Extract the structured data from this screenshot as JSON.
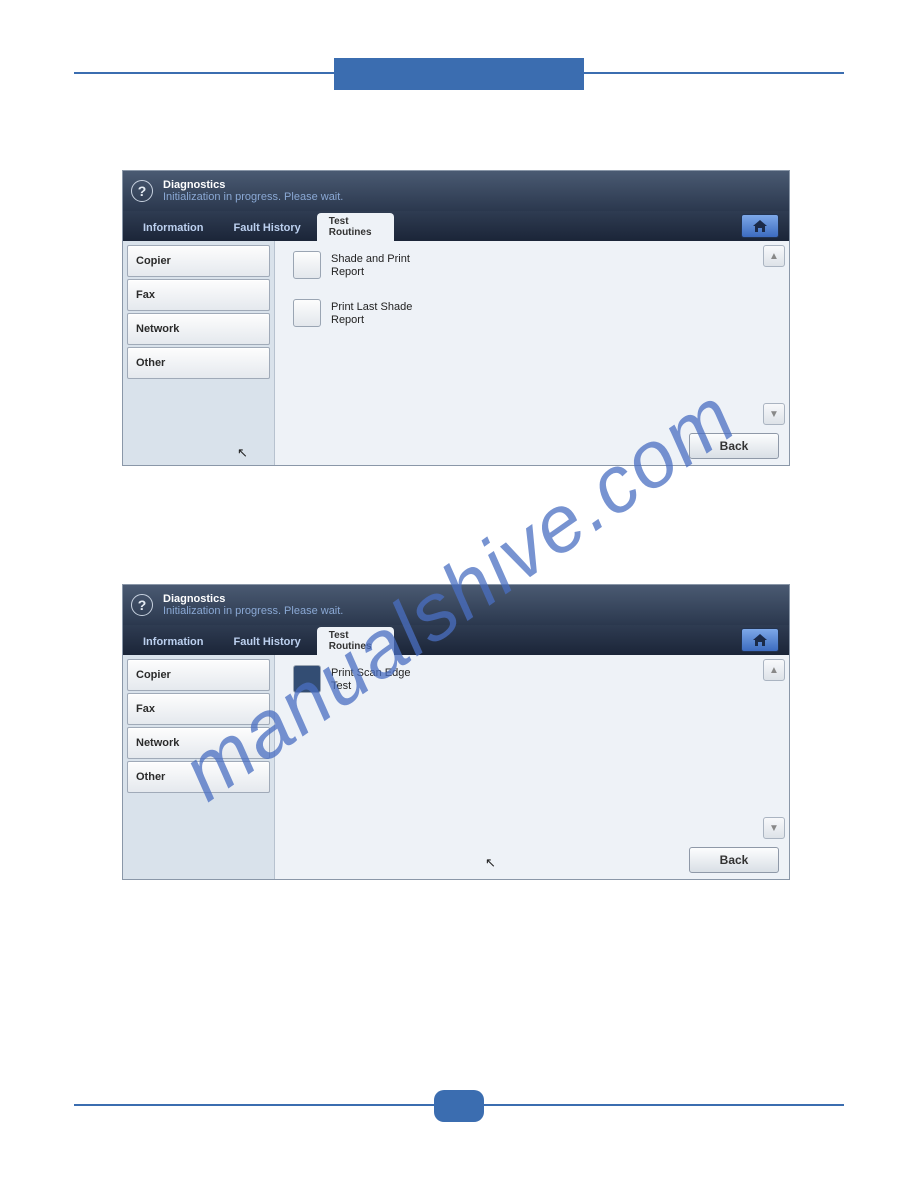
{
  "watermark": "manualshive.com",
  "panels": [
    {
      "title": "Diagnostics",
      "subtitle": "Initialization in progress. Please wait.",
      "tabs": {
        "info": "Information",
        "fault": "Fault History",
        "test_l1": "Test",
        "test_l2": "Routines"
      },
      "sidebar": {
        "copier": "Copier",
        "fax": "Fax",
        "network": "Network",
        "other": "Other"
      },
      "options": {
        "opt1_l1": "Shade and Print",
        "opt1_l2": "Report",
        "opt2_l1": "Print Last Shade",
        "opt2_l2": "Report"
      },
      "back": "Back"
    },
    {
      "title": "Diagnostics",
      "subtitle": "Initialization in progress. Please wait.",
      "tabs": {
        "info": "Information",
        "fault": "Fault History",
        "test_l1": "Test",
        "test_l2": "Routines"
      },
      "sidebar": {
        "copier": "Copier",
        "fax": "Fax",
        "network": "Network",
        "other": "Other"
      },
      "options": {
        "opt1_l1": "Print Scan Edge",
        "opt1_l2": "Test"
      },
      "back": "Back"
    }
  ]
}
